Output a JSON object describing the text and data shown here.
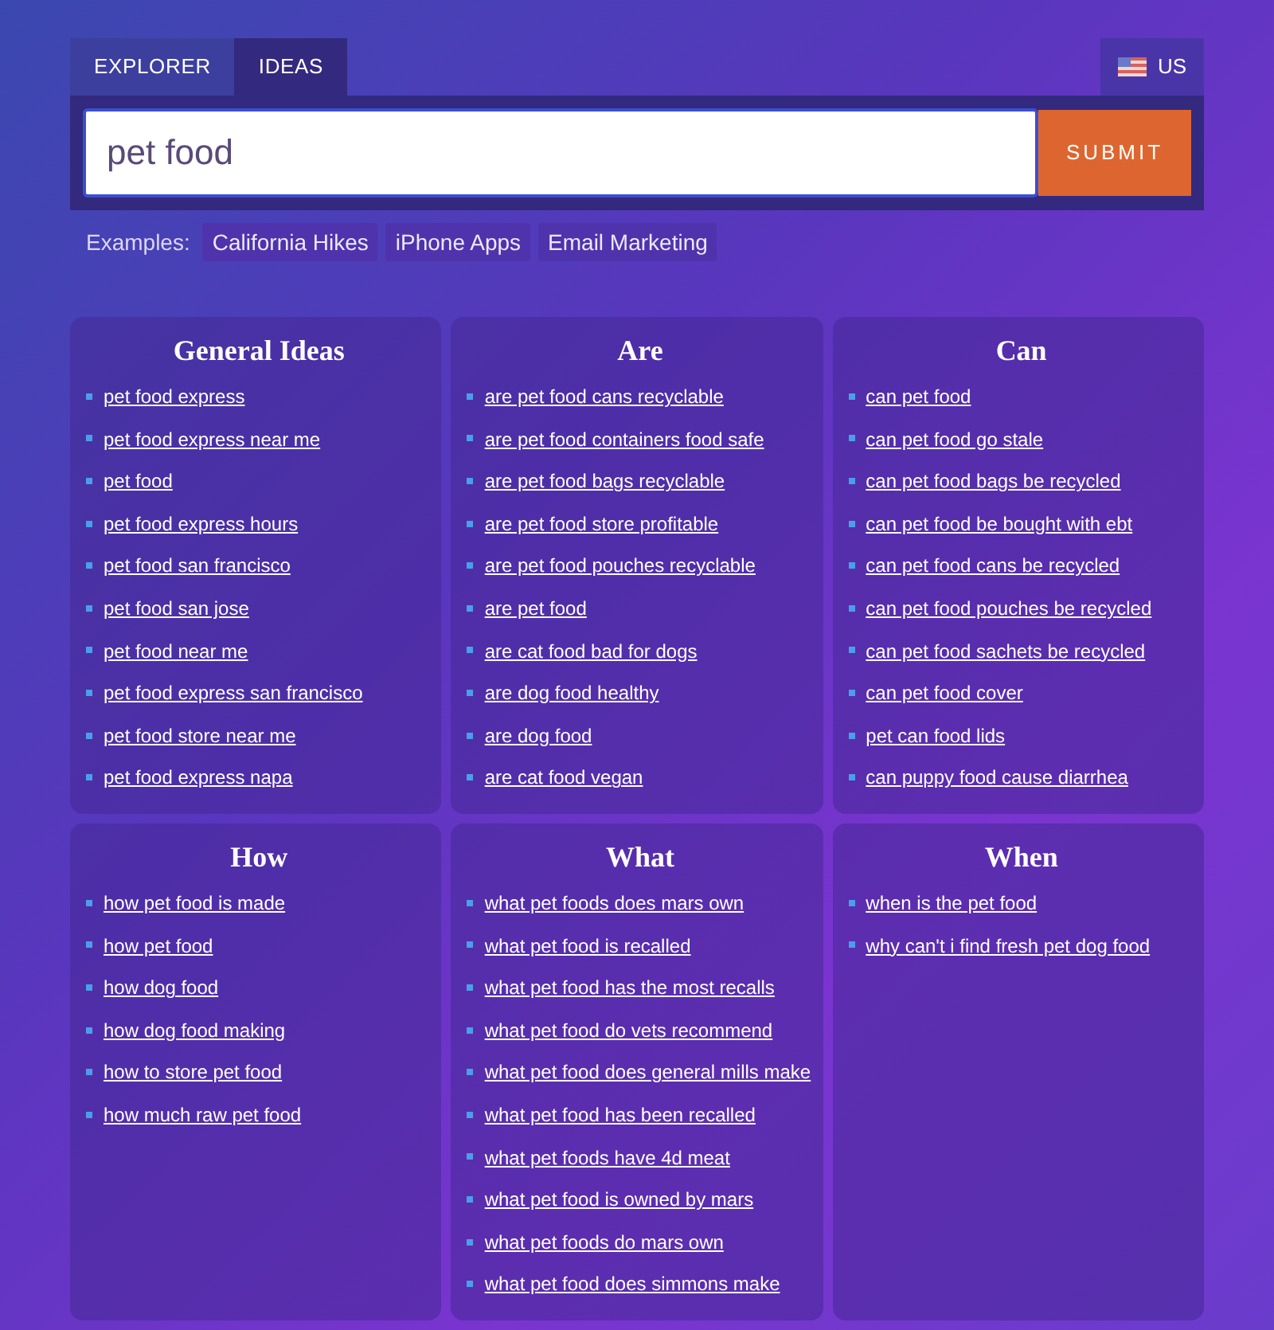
{
  "tabs": [
    {
      "label": "EXPLORER",
      "selected": false
    },
    {
      "label": "IDEAS",
      "selected": true
    }
  ],
  "country": {
    "label": "US"
  },
  "search": {
    "value": "pet food",
    "button": "SUBMIT"
  },
  "examples": {
    "label": "Examples:",
    "items": [
      "California Hikes",
      "iPhone Apps",
      "Email Marketing"
    ]
  },
  "cards": [
    {
      "title": "General Ideas",
      "items": [
        "pet food express",
        "pet food express near me",
        "pet food",
        "pet food express hours",
        "pet food san francisco",
        "pet food san jose",
        "pet food near me",
        "pet food express san francisco",
        "pet food store near me",
        "pet food express napa"
      ]
    },
    {
      "title": "Are",
      "items": [
        "are pet food cans recyclable",
        "are pet food containers food safe",
        "are pet food bags recyclable",
        "are pet food store profitable",
        "are pet food pouches recyclable",
        "are pet food",
        "are cat food bad for dogs",
        "are dog food healthy",
        "are dog food",
        "are cat food vegan"
      ]
    },
    {
      "title": "Can",
      "items": [
        "can pet food",
        "can pet food go stale",
        "can pet food bags be recycled",
        "can pet food be bought with ebt",
        "can pet food cans be recycled",
        "can pet food pouches be recycled",
        "can pet food sachets be recycled",
        "can pet food cover",
        "pet can food lids",
        "can puppy food cause diarrhea"
      ]
    },
    {
      "title": "How",
      "items": [
        "how pet food is made",
        "how pet food",
        "how dog food",
        "how dog food making",
        "how to store pet food",
        "how much raw pet food"
      ]
    },
    {
      "title": "What",
      "items": [
        "what pet foods does mars own",
        "what pet food is recalled",
        "what pet food has the most recalls",
        "what pet food do vets recommend",
        "what pet food does general mills make",
        "what pet food has been recalled",
        "what pet foods have 4d meat",
        "what pet food is owned by mars",
        "what pet foods do mars own",
        "what pet food does simmons make"
      ]
    },
    {
      "title": "When",
      "items": [
        "when is the pet food",
        "why can't i find fresh pet dog food"
      ]
    }
  ]
}
